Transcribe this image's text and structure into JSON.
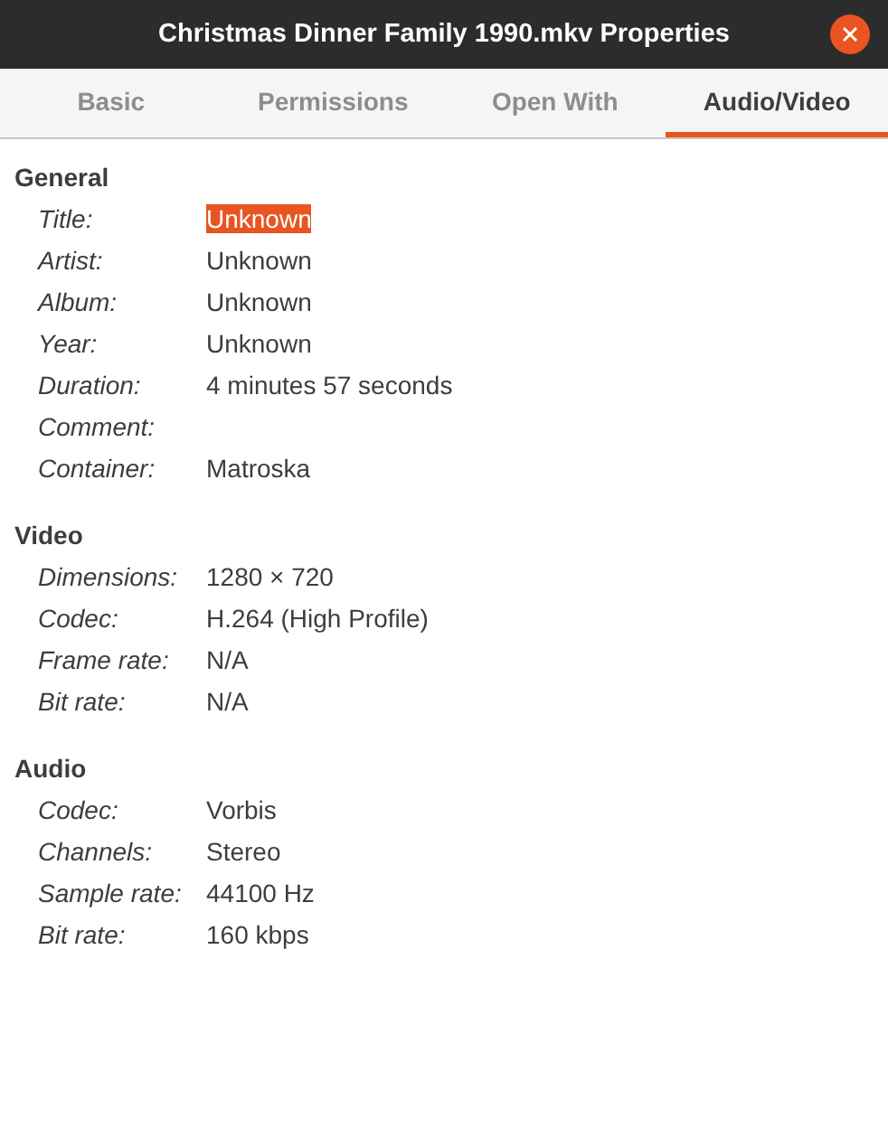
{
  "window": {
    "title": "Christmas Dinner Family 1990.mkv Properties"
  },
  "tabs": [
    {
      "label": "Basic",
      "selected": false
    },
    {
      "label": "Permissions",
      "selected": false
    },
    {
      "label": "Open With",
      "selected": false
    },
    {
      "label": "Audio/Video",
      "selected": true
    }
  ],
  "sections": [
    {
      "heading": "General",
      "rows": [
        {
          "label": "Title:",
          "value": "Unknown",
          "selected": true
        },
        {
          "label": "Artist:",
          "value": "Unknown",
          "selected": false
        },
        {
          "label": "Album:",
          "value": "Unknown",
          "selected": false
        },
        {
          "label": "Year:",
          "value": "Unknown",
          "selected": false
        },
        {
          "label": "Duration:",
          "value": "4 minutes 57 seconds",
          "selected": false
        },
        {
          "label": "Comment:",
          "selected": false
        },
        {
          "label": "Container:",
          "value": "Matroska",
          "selected": false
        }
      ]
    },
    {
      "heading": "Video",
      "rows": [
        {
          "label": "Dimensions:",
          "value": "1280 × 720",
          "selected": false
        },
        {
          "label": "Codec:",
          "value": "H.264 (High Profile)",
          "selected": false
        },
        {
          "label": "Frame rate:",
          "value": "N/A",
          "selected": false
        },
        {
          "label": "Bit rate:",
          "value": "N/A",
          "selected": false
        }
      ]
    },
    {
      "heading": "Audio",
      "rows": [
        {
          "label": "Codec:",
          "value": "Vorbis",
          "selected": false
        },
        {
          "label": "Channels:",
          "value": "Stereo",
          "selected": false
        },
        {
          "label": "Sample rate:",
          "value": "44100 Hz",
          "selected": false
        },
        {
          "label": "Bit rate:",
          "value": "160 kbps",
          "selected": false
        }
      ]
    }
  ]
}
